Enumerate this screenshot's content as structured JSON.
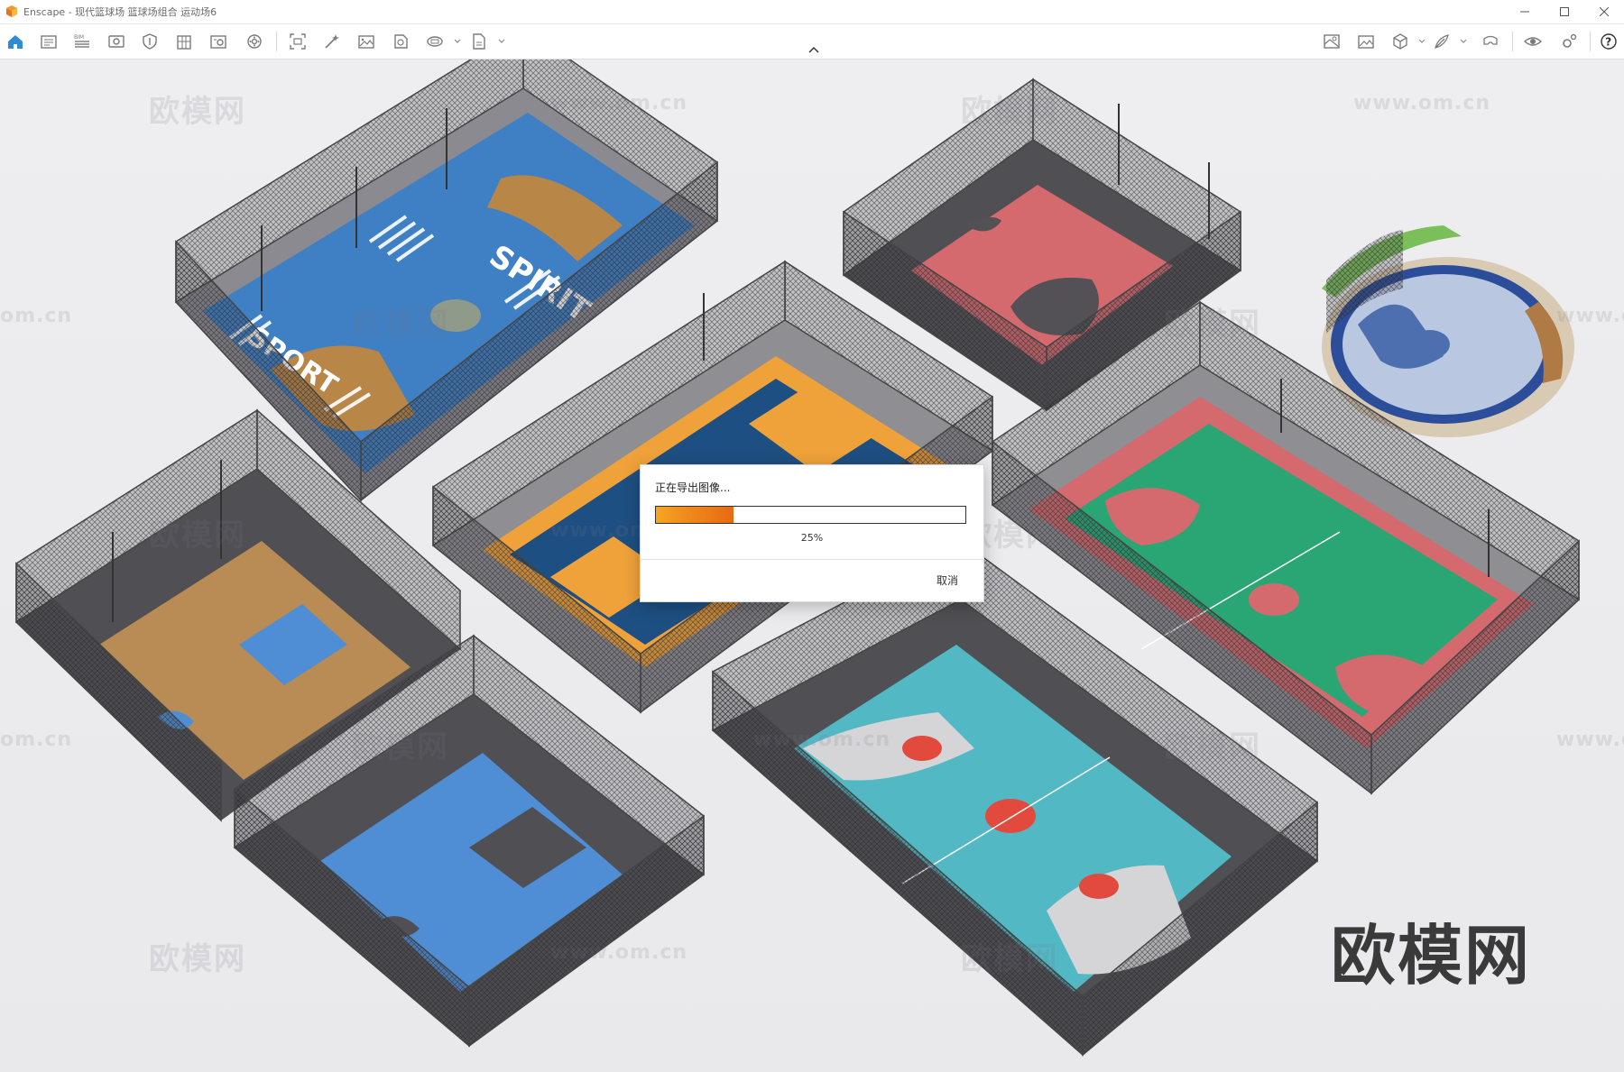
{
  "window": {
    "title": "Enscape - 现代篮球场 篮球场组合 运动场6",
    "controls": [
      "minimize-icon",
      "maximize-icon",
      "close-icon"
    ]
  },
  "toolbar": {
    "left_icons": [
      "home-icon",
      "video-editor-icon",
      "bim-icon",
      "views-icon",
      "shield-icon",
      "building-icon",
      "asset-library-icon",
      "settings-wheel-icon",
      "screenshot-icon",
      "magic-wand-icon",
      "image-export-icon",
      "batch-render-icon",
      "panorama-icon",
      "export-file-icon"
    ],
    "right_icons": [
      "map-icon",
      "image-icon",
      "cube-icon",
      "feather-icon",
      "vr-headset-icon",
      "eye-icon",
      "gear-icon",
      "help-icon"
    ],
    "accent_color": "#2e8bd8"
  },
  "viewport": {
    "watermark_text": "欧模网",
    "watermark_url": "www.om.cn",
    "watermark_partial_left": "om.cn",
    "watermark_partial_right": "www.o",
    "court_text_1": "SPIRIT",
    "court_text_2": "SPORT"
  },
  "dialog": {
    "title": "正在导出图像...",
    "progress_percent": 25,
    "progress_label": "25%",
    "cancel_label": "取消"
  }
}
